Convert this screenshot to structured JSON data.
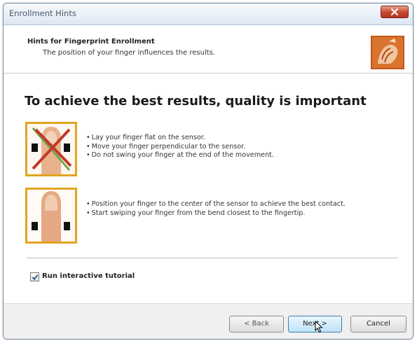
{
  "window": {
    "title": "Enrollment Hints"
  },
  "header": {
    "title": "Hints for Fingerprint Enrollment",
    "subtitle": "The position of your finger influences the results.",
    "icon": "fingerprint-hand-icon"
  },
  "main": {
    "heading": "To achieve the best results, quality is important",
    "hints_bad": [
      "Lay your finger flat on the sensor.",
      "Move your finger perpendicular to the sensor.",
      "Do not swing your finger at the end of the movement."
    ],
    "hints_good": [
      "Position your finger to the center of the sensor to achieve the best contact.",
      "Start swiping your finger from the bend closest to the fingertip."
    ],
    "tutorial_label": "Run interactive tutorial",
    "tutorial_checked": true
  },
  "buttons": {
    "back": "< Back",
    "next": "Next >",
    "cancel": "Cancel"
  },
  "colors": {
    "accent_border": "#e2a422",
    "header_bg": "#ffffff",
    "footer_bg": "#f0f0f0"
  }
}
